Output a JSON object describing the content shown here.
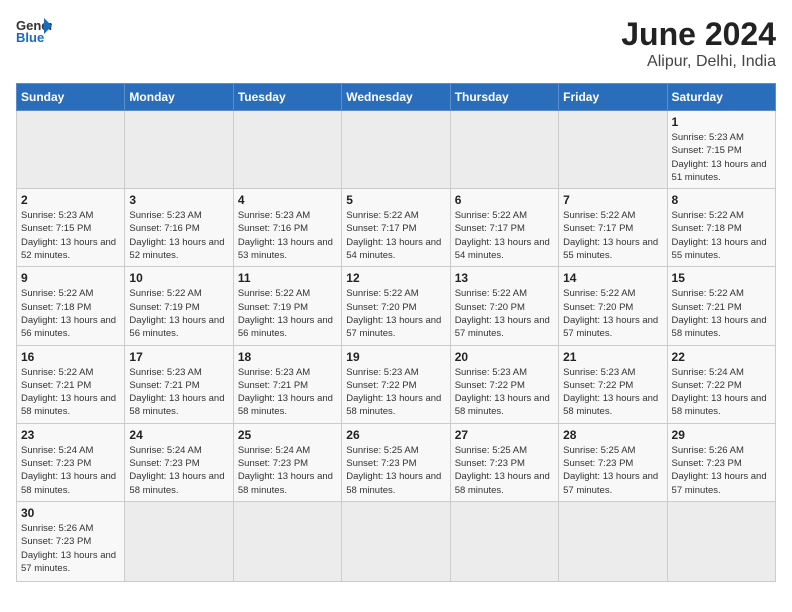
{
  "logo": {
    "text_general": "General",
    "text_blue": "Blue"
  },
  "title": "June 2024",
  "subtitle": "Alipur, Delhi, India",
  "days": [
    "Sunday",
    "Monday",
    "Tuesday",
    "Wednesday",
    "Thursday",
    "Friday",
    "Saturday"
  ],
  "weeks": [
    [
      {
        "num": "",
        "empty": true
      },
      {
        "num": "",
        "empty": true
      },
      {
        "num": "",
        "empty": true
      },
      {
        "num": "",
        "empty": true
      },
      {
        "num": "",
        "empty": true
      },
      {
        "num": "",
        "empty": true
      },
      {
        "num": "1",
        "sunrise": "5:23 AM",
        "sunset": "7:15 PM",
        "daylight": "13 hours and 51 minutes."
      }
    ],
    [
      {
        "num": "2",
        "sunrise": "5:23 AM",
        "sunset": "7:15 PM",
        "daylight": "13 hours and 52 minutes."
      },
      {
        "num": "3",
        "sunrise": "5:23 AM",
        "sunset": "7:16 PM",
        "daylight": "13 hours and 52 minutes."
      },
      {
        "num": "4",
        "sunrise": "5:23 AM",
        "sunset": "7:16 PM",
        "daylight": "13 hours and 53 minutes."
      },
      {
        "num": "5",
        "sunrise": "5:22 AM",
        "sunset": "7:17 PM",
        "daylight": "13 hours and 54 minutes."
      },
      {
        "num": "6",
        "sunrise": "5:22 AM",
        "sunset": "7:17 PM",
        "daylight": "13 hours and 54 minutes."
      },
      {
        "num": "7",
        "sunrise": "5:22 AM",
        "sunset": "7:17 PM",
        "daylight": "13 hours and 55 minutes."
      },
      {
        "num": "8",
        "sunrise": "5:22 AM",
        "sunset": "7:18 PM",
        "daylight": "13 hours and 55 minutes."
      }
    ],
    [
      {
        "num": "9",
        "sunrise": "5:22 AM",
        "sunset": "7:18 PM",
        "daylight": "13 hours and 56 minutes."
      },
      {
        "num": "10",
        "sunrise": "5:22 AM",
        "sunset": "7:19 PM",
        "daylight": "13 hours and 56 minutes."
      },
      {
        "num": "11",
        "sunrise": "5:22 AM",
        "sunset": "7:19 PM",
        "daylight": "13 hours and 56 minutes."
      },
      {
        "num": "12",
        "sunrise": "5:22 AM",
        "sunset": "7:20 PM",
        "daylight": "13 hours and 57 minutes."
      },
      {
        "num": "13",
        "sunrise": "5:22 AM",
        "sunset": "7:20 PM",
        "daylight": "13 hours and 57 minutes."
      },
      {
        "num": "14",
        "sunrise": "5:22 AM",
        "sunset": "7:20 PM",
        "daylight": "13 hours and 57 minutes."
      },
      {
        "num": "15",
        "sunrise": "5:22 AM",
        "sunset": "7:21 PM",
        "daylight": "13 hours and 58 minutes."
      }
    ],
    [
      {
        "num": "16",
        "sunrise": "5:22 AM",
        "sunset": "7:21 PM",
        "daylight": "13 hours and 58 minutes."
      },
      {
        "num": "17",
        "sunrise": "5:23 AM",
        "sunset": "7:21 PM",
        "daylight": "13 hours and 58 minutes."
      },
      {
        "num": "18",
        "sunrise": "5:23 AM",
        "sunset": "7:21 PM",
        "daylight": "13 hours and 58 minutes."
      },
      {
        "num": "19",
        "sunrise": "5:23 AM",
        "sunset": "7:22 PM",
        "daylight": "13 hours and 58 minutes."
      },
      {
        "num": "20",
        "sunrise": "5:23 AM",
        "sunset": "7:22 PM",
        "daylight": "13 hours and 58 minutes."
      },
      {
        "num": "21",
        "sunrise": "5:23 AM",
        "sunset": "7:22 PM",
        "daylight": "13 hours and 58 minutes."
      },
      {
        "num": "22",
        "sunrise": "5:24 AM",
        "sunset": "7:22 PM",
        "daylight": "13 hours and 58 minutes."
      }
    ],
    [
      {
        "num": "23",
        "sunrise": "5:24 AM",
        "sunset": "7:23 PM",
        "daylight": "13 hours and 58 minutes."
      },
      {
        "num": "24",
        "sunrise": "5:24 AM",
        "sunset": "7:23 PM",
        "daylight": "13 hours and 58 minutes."
      },
      {
        "num": "25",
        "sunrise": "5:24 AM",
        "sunset": "7:23 PM",
        "daylight": "13 hours and 58 minutes."
      },
      {
        "num": "26",
        "sunrise": "5:25 AM",
        "sunset": "7:23 PM",
        "daylight": "13 hours and 58 minutes."
      },
      {
        "num": "27",
        "sunrise": "5:25 AM",
        "sunset": "7:23 PM",
        "daylight": "13 hours and 58 minutes."
      },
      {
        "num": "28",
        "sunrise": "5:25 AM",
        "sunset": "7:23 PM",
        "daylight": "13 hours and 57 minutes."
      },
      {
        "num": "29",
        "sunrise": "5:26 AM",
        "sunset": "7:23 PM",
        "daylight": "13 hours and 57 minutes."
      }
    ],
    [
      {
        "num": "30",
        "sunrise": "5:26 AM",
        "sunset": "7:23 PM",
        "daylight": "13 hours and 57 minutes."
      },
      {
        "num": "",
        "empty": true
      },
      {
        "num": "",
        "empty": true
      },
      {
        "num": "",
        "empty": true
      },
      {
        "num": "",
        "empty": true
      },
      {
        "num": "",
        "empty": true
      },
      {
        "num": "",
        "empty": true
      }
    ]
  ],
  "cell_labels": {
    "sunrise": "Sunrise:",
    "sunset": "Sunset:",
    "daylight": "Daylight:"
  }
}
